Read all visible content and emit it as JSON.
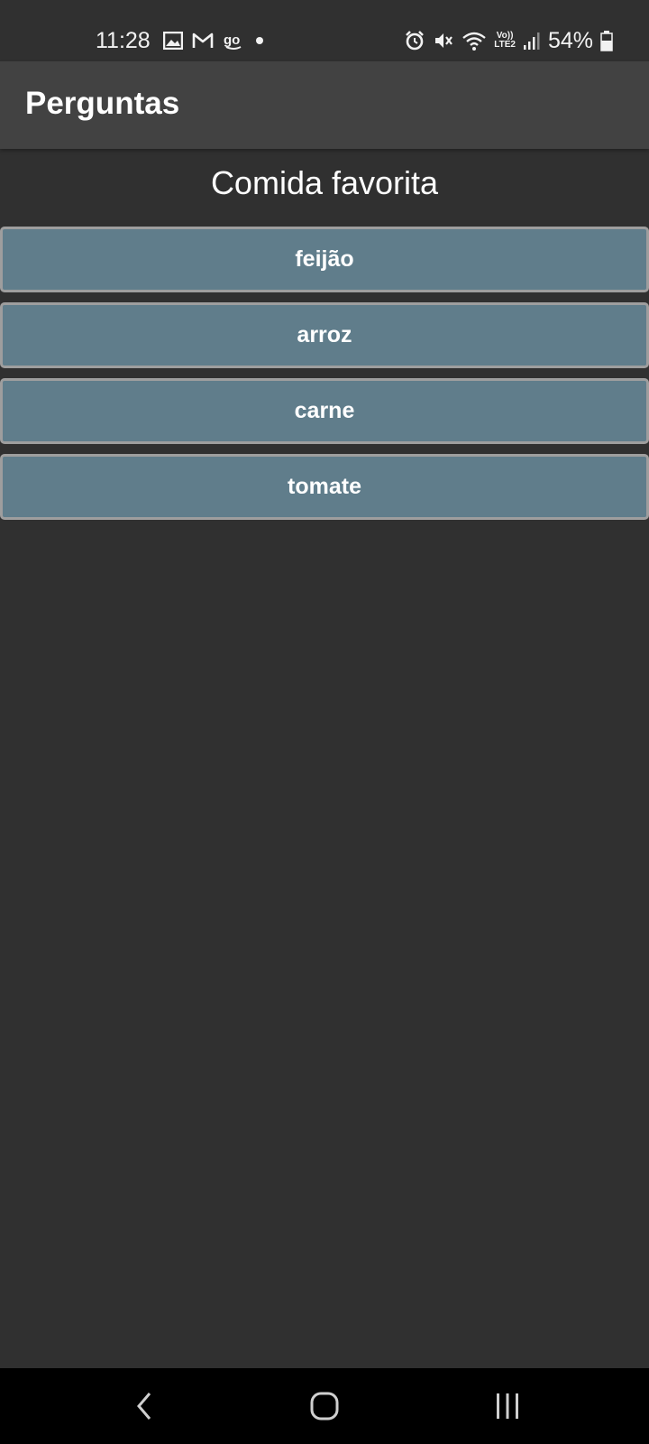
{
  "status_bar": {
    "time": "11:28",
    "notification_icons": [
      "gallery-icon",
      "gmail-icon",
      "go-app-icon",
      "dot-icon"
    ],
    "system_icons": [
      "alarm-icon",
      "mute-vibrate-icon",
      "wifi-icon",
      "volte-lte2-icon",
      "signal-icon"
    ],
    "volte_label": "Vo))",
    "lte_label": "LTE2",
    "battery_percent": "54%"
  },
  "app_bar": {
    "title": "Perguntas"
  },
  "question": {
    "text": "Comida favorita"
  },
  "answers": [
    {
      "label": "feijão"
    },
    {
      "label": "arroz"
    },
    {
      "label": "carne"
    },
    {
      "label": "tomate"
    }
  ],
  "nav_bar": {
    "icons": [
      "back-icon",
      "home-icon",
      "recent-apps-icon"
    ]
  },
  "colors": {
    "background": "#303030",
    "app_bar": "#424242",
    "button": "#607d8b",
    "button_border": "#9e9e9e"
  }
}
